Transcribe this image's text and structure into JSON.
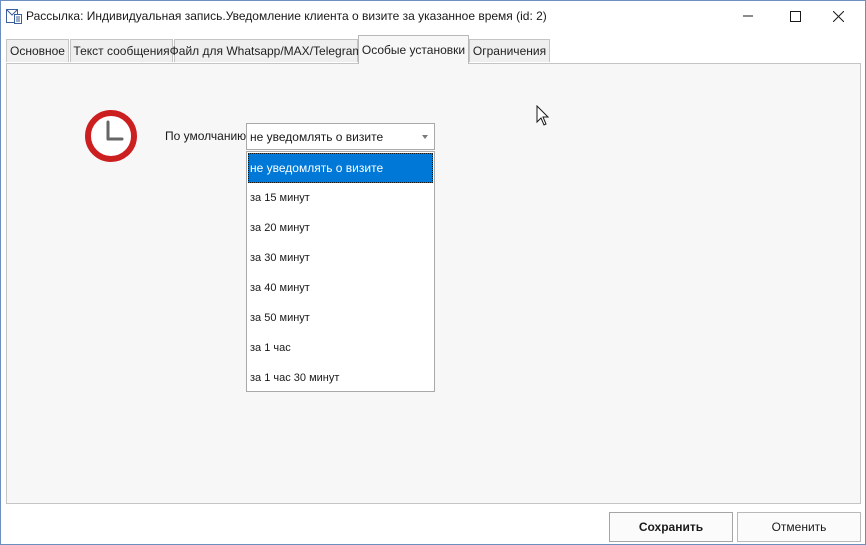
{
  "window": {
    "title": "Рассылка: Индивидуальная запись.Уведомление клиента о визите за указанное время (id: 2)"
  },
  "tabs": [
    {
      "label": "Основное",
      "active": false
    },
    {
      "label": "Текст сообщения",
      "active": false
    },
    {
      "label": "Файл для Whatsapp/MAX/Telegram",
      "active": false
    },
    {
      "label": "Особые установки",
      "active": true
    },
    {
      "label": "Ограничения",
      "active": false
    }
  ],
  "settings": {
    "default_label": "По умолчанию:",
    "selected_value": "не уведомлять о визите",
    "options": [
      "не уведомлять о визите",
      "за 15 минут",
      "за 20 минут",
      "за 30 минут",
      "за 40 минут",
      "за 50 минут",
      "за 1 час",
      "за 1 час 30 минут"
    ],
    "clock_icon": "clock-icon",
    "accent_color": "#cc1f1f",
    "selection_color": "#0078d7"
  },
  "footer": {
    "save_label": "Сохранить",
    "cancel_label": "Отменить"
  }
}
